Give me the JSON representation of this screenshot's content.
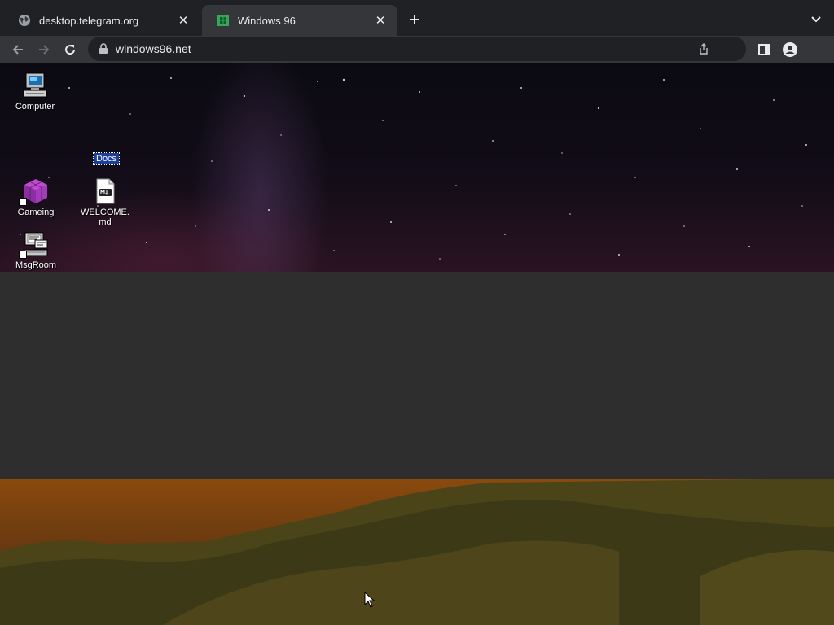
{
  "browser": {
    "tabs": [
      {
        "title": "desktop.telegram.org",
        "favicon": "globe-icon",
        "active": false
      },
      {
        "title": "Windows 96",
        "favicon": "windows96-favicon",
        "active": true
      }
    ],
    "address": "windows96.net"
  },
  "desktop": {
    "icons": [
      {
        "label": "Computer",
        "icon": "computer-icon"
      },
      {
        "label": "Gameing",
        "icon": "purple-cube-icon"
      },
      {
        "label": "MsgRoom",
        "icon": "msgroom-icon"
      },
      {
        "label": "WELCOME.md",
        "icon": "markdown-file-icon"
      }
    ],
    "selected_folder_label": "Docs"
  },
  "colors": {
    "chrome_dark": "#202124",
    "chrome_toolbar": "#35363a",
    "selection": "#1c3f9b"
  }
}
